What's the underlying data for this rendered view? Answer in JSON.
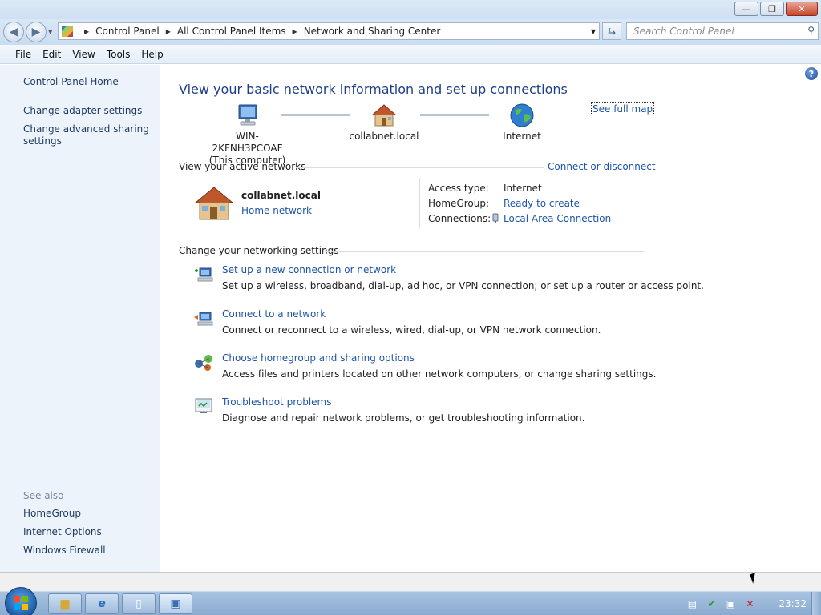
{
  "window": {
    "buttons": {
      "minimize": "—",
      "maximize": "❐",
      "close": "✕"
    }
  },
  "nav": {
    "back_icon": "back-arrow-icon",
    "forward_icon": "forward-arrow-icon",
    "breadcrumbs": [
      "Control Panel",
      "All Control Panel Items",
      "Network and Sharing Center"
    ],
    "search_placeholder": "Search Control Panel"
  },
  "menu": [
    "File",
    "Edit",
    "View",
    "Tools",
    "Help"
  ],
  "sidebar": {
    "home": "Control Panel Home",
    "items": [
      "Change adapter settings",
      "Change advanced sharing settings"
    ],
    "see_also_label": "See also",
    "see_also": [
      "HomeGroup",
      "Internet Options",
      "Windows Firewall"
    ]
  },
  "main": {
    "title": "View your basic network information and set up connections",
    "see_full_map": "See full map",
    "map": {
      "computer_name": "WIN-2KFNH3PCOAF",
      "computer_sub": "(This computer)",
      "network": "collabnet.local",
      "internet": "Internet"
    },
    "active_networks": {
      "header": "View your active networks",
      "connect_link": "Connect or disconnect",
      "network_name": "collabnet.local",
      "network_type": "Home network",
      "access_type_label": "Access type:",
      "access_type_value": "Internet",
      "homegroup_label": "HomeGroup:",
      "homegroup_value": "Ready to create",
      "connections_label": "Connections:",
      "connections_value": "Local Area Connection"
    },
    "settings": {
      "header": "Change your networking settings",
      "tasks": [
        {
          "title": "Set up a new connection or network",
          "desc": "Set up a wireless, broadband, dial-up, ad hoc, or VPN connection; or set up a router or access point."
        },
        {
          "title": "Connect to a network",
          "desc": "Connect or reconnect to a wireless, wired, dial-up, or VPN network connection."
        },
        {
          "title": "Choose homegroup and sharing options",
          "desc": "Access files and printers located on other network computers, or change sharing settings."
        },
        {
          "title": "Troubleshoot problems",
          "desc": "Diagnose and repair network problems, or get troubleshooting information."
        }
      ]
    }
  },
  "taskbar": {
    "clock": "23:32"
  },
  "colors": {
    "link": "#1e55a8",
    "heading": "#1e3f8a",
    "sidebar_bg": "#ecf3fb"
  }
}
